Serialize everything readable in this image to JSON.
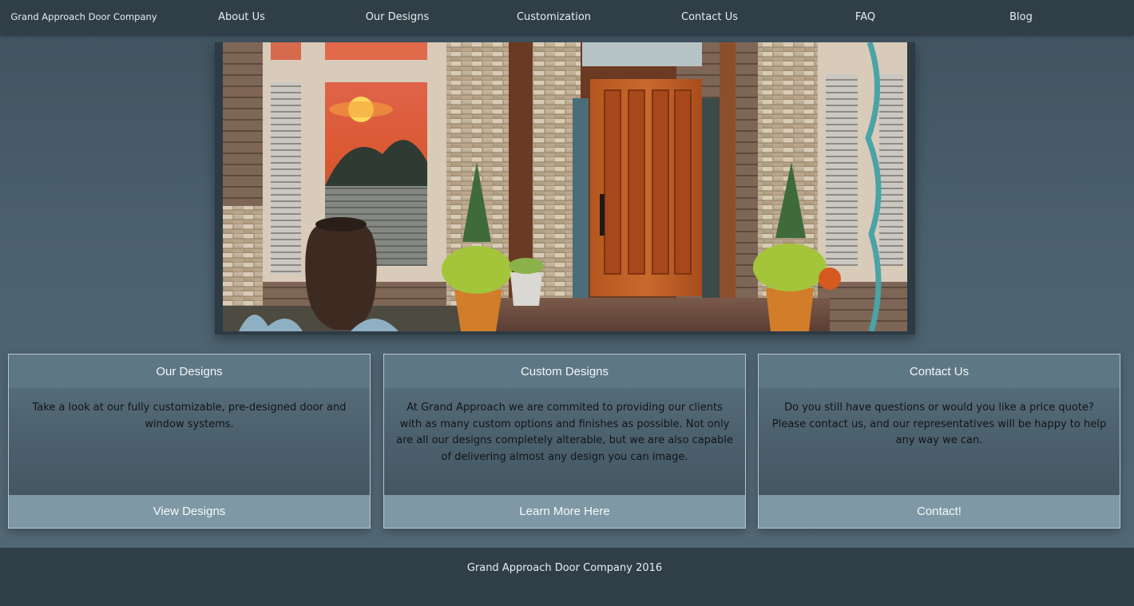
{
  "nav": {
    "brand": "Grand Approach Door Company",
    "items": [
      {
        "label": "About Us"
      },
      {
        "label": "Our Designs"
      },
      {
        "label": "Customization"
      },
      {
        "label": "Contact Us"
      },
      {
        "label": "FAQ"
      },
      {
        "label": "Blog"
      }
    ]
  },
  "hero": {
    "image": "house-front-door-photo"
  },
  "cards": [
    {
      "title": "Our Designs",
      "body": "Take a look at our fully customizable, pre-designed door and window systems.",
      "button": "View Designs"
    },
    {
      "title": "Custom Designs",
      "body": "At Grand Approach we are commited to providing our clients with as many custom options and finishes as possible. Not only are all our designs completely alterable, but we are also capable of delivering almost any design you can image.",
      "button": "Learn More Here"
    },
    {
      "title": "Contact Us",
      "body": "Do you still have questions or would you like a price quote? Please contact us, and our representatives will be happy to help any way we can.",
      "button": "Contact!"
    }
  ],
  "footer": {
    "text": "Grand Approach Door Company 2016"
  },
  "colors": {
    "navbar": "#2f3e47",
    "card_header": "#5e7785",
    "card_button": "#7f98a5",
    "background": "#4d6270"
  }
}
